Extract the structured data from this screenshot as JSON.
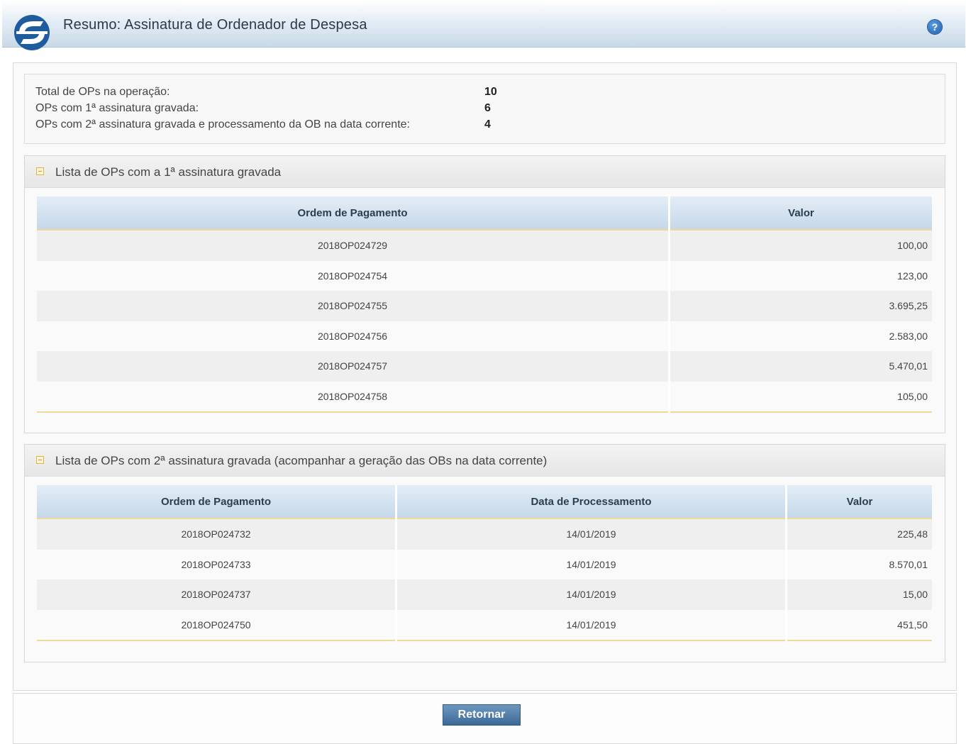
{
  "header": {
    "title": "Resumo: Assinatura de Ordenador de Despesa",
    "logo_icon": "siafi-logo-icon",
    "help_icon": "help-icon",
    "help_glyph": "?"
  },
  "summary": {
    "total_label": "Total de OPs na operação:",
    "total_value": "10",
    "first_sig_label": "OPs com 1ª assinatura gravada:",
    "first_sig_value": "6",
    "second_sig_label": "OPs com 2ª assinatura gravada e processamento da OB na data corrente:",
    "second_sig_value": "4"
  },
  "section1": {
    "title": "Lista de OPs com a 1ª assinatura gravada",
    "columns": [
      "Ordem de Pagamento",
      "Valor"
    ],
    "rows": [
      [
        "2018OP024729",
        "100,00"
      ],
      [
        "2018OP024754",
        "123,00"
      ],
      [
        "2018OP024755",
        "3.695,25"
      ],
      [
        "2018OP024756",
        "2.583,00"
      ],
      [
        "2018OP024757",
        "5.470,01"
      ],
      [
        "2018OP024758",
        "105,00"
      ]
    ]
  },
  "section2": {
    "title": "Lista de OPs com 2ª assinatura gravada (acompanhar a geração das OBs na data corrente)",
    "columns": [
      "Ordem de Pagamento",
      "Data de Processamento",
      "Valor"
    ],
    "rows": [
      [
        "2018OP024732",
        "14/01/2019",
        "225,48"
      ],
      [
        "2018OP024733",
        "14/01/2019",
        "8.570,01"
      ],
      [
        "2018OP024737",
        "14/01/2019",
        "15,00"
      ],
      [
        "2018OP024750",
        "14/01/2019",
        "451,50"
      ]
    ]
  },
  "footer": {
    "return_label": "Retornar"
  },
  "colors": {
    "header_text": "#2b3845",
    "table_header_bg": "#c5d8ea",
    "accent_line": "#f0d89a",
    "button_bg": "#3c6a97"
  }
}
